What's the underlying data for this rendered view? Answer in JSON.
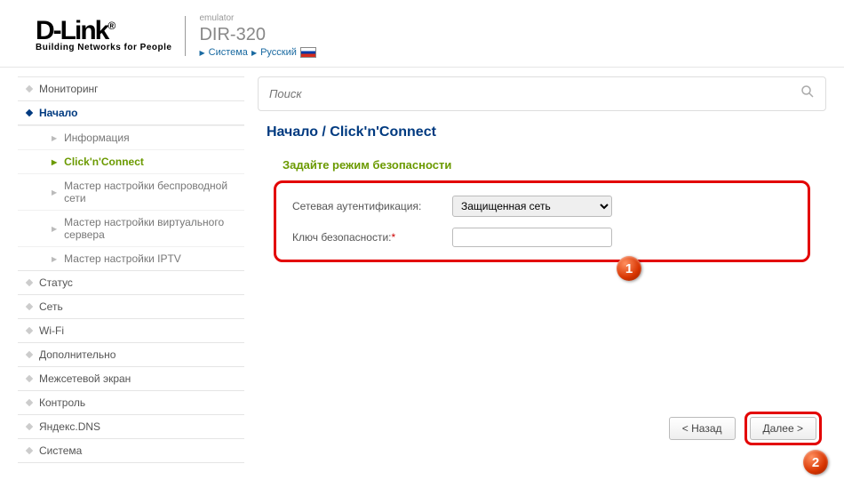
{
  "header": {
    "logo_main": "D-Link",
    "logo_sub": "Building Networks for People",
    "emulator": "emulator",
    "model": "DIR-320",
    "crumb_system": "Система",
    "crumb_lang": "Русский"
  },
  "search": {
    "placeholder": "Поиск"
  },
  "sidebar": {
    "items": [
      {
        "label": "Мониторинг",
        "expanded": false
      },
      {
        "label": "Начало",
        "expanded": true,
        "children": [
          {
            "label": "Информация",
            "active": false
          },
          {
            "label": "Click'n'Connect",
            "active": true
          },
          {
            "label": "Мастер настройки беспроводной сети",
            "active": false
          },
          {
            "label": "Мастер настройки виртуального сервера",
            "active": false
          },
          {
            "label": "Мастер настройки IPTV",
            "active": false
          }
        ]
      },
      {
        "label": "Статус",
        "expanded": false
      },
      {
        "label": "Сеть",
        "expanded": false
      },
      {
        "label": "Wi-Fi",
        "expanded": false
      },
      {
        "label": "Дополнительно",
        "expanded": false
      },
      {
        "label": "Межсетевой экран",
        "expanded": false
      },
      {
        "label": "Контроль",
        "expanded": false
      },
      {
        "label": "Яндекс.DNS",
        "expanded": false
      },
      {
        "label": "Система",
        "expanded": false
      }
    ]
  },
  "main": {
    "breadcrumb": "Начало /  Click'n'Connect",
    "section_title": "Задайте режим безопасности",
    "auth_label": "Сетевая аутентификация:",
    "auth_value": "Защищенная сеть",
    "key_label": "Ключ безопасности:",
    "key_value": "",
    "back_btn": "< Назад",
    "next_btn": "Далее >"
  },
  "badges": {
    "one": "1",
    "two": "2"
  }
}
